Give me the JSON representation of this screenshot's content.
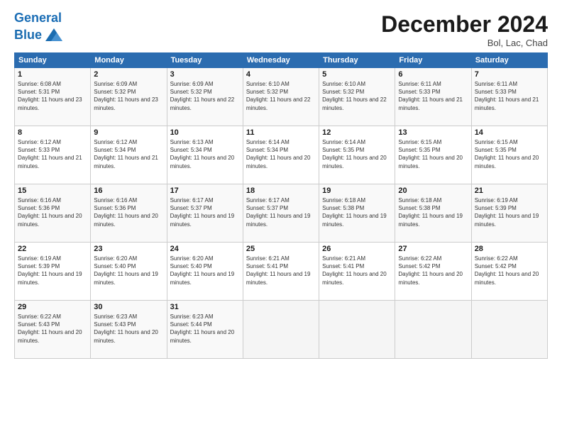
{
  "header": {
    "logo_line1": "General",
    "logo_line2": "Blue",
    "month_title": "December 2024",
    "subtitle": "Bol, Lac, Chad"
  },
  "weekdays": [
    "Sunday",
    "Monday",
    "Tuesday",
    "Wednesday",
    "Thursday",
    "Friday",
    "Saturday"
  ],
  "weeks": [
    [
      {
        "day": "1",
        "sunrise": "6:08 AM",
        "sunset": "5:31 PM",
        "daylight": "11 hours and 23 minutes."
      },
      {
        "day": "2",
        "sunrise": "6:09 AM",
        "sunset": "5:32 PM",
        "daylight": "11 hours and 23 minutes."
      },
      {
        "day": "3",
        "sunrise": "6:09 AM",
        "sunset": "5:32 PM",
        "daylight": "11 hours and 22 minutes."
      },
      {
        "day": "4",
        "sunrise": "6:10 AM",
        "sunset": "5:32 PM",
        "daylight": "11 hours and 22 minutes."
      },
      {
        "day": "5",
        "sunrise": "6:10 AM",
        "sunset": "5:32 PM",
        "daylight": "11 hours and 22 minutes."
      },
      {
        "day": "6",
        "sunrise": "6:11 AM",
        "sunset": "5:33 PM",
        "daylight": "11 hours and 21 minutes."
      },
      {
        "day": "7",
        "sunrise": "6:11 AM",
        "sunset": "5:33 PM",
        "daylight": "11 hours and 21 minutes."
      }
    ],
    [
      {
        "day": "8",
        "sunrise": "6:12 AM",
        "sunset": "5:33 PM",
        "daylight": "11 hours and 21 minutes."
      },
      {
        "day": "9",
        "sunrise": "6:12 AM",
        "sunset": "5:34 PM",
        "daylight": "11 hours and 21 minutes."
      },
      {
        "day": "10",
        "sunrise": "6:13 AM",
        "sunset": "5:34 PM",
        "daylight": "11 hours and 20 minutes."
      },
      {
        "day": "11",
        "sunrise": "6:14 AM",
        "sunset": "5:34 PM",
        "daylight": "11 hours and 20 minutes."
      },
      {
        "day": "12",
        "sunrise": "6:14 AM",
        "sunset": "5:35 PM",
        "daylight": "11 hours and 20 minutes."
      },
      {
        "day": "13",
        "sunrise": "6:15 AM",
        "sunset": "5:35 PM",
        "daylight": "11 hours and 20 minutes."
      },
      {
        "day": "14",
        "sunrise": "6:15 AM",
        "sunset": "5:35 PM",
        "daylight": "11 hours and 20 minutes."
      }
    ],
    [
      {
        "day": "15",
        "sunrise": "6:16 AM",
        "sunset": "5:36 PM",
        "daylight": "11 hours and 20 minutes."
      },
      {
        "day": "16",
        "sunrise": "6:16 AM",
        "sunset": "5:36 PM",
        "daylight": "11 hours and 20 minutes."
      },
      {
        "day": "17",
        "sunrise": "6:17 AM",
        "sunset": "5:37 PM",
        "daylight": "11 hours and 19 minutes."
      },
      {
        "day": "18",
        "sunrise": "6:17 AM",
        "sunset": "5:37 PM",
        "daylight": "11 hours and 19 minutes."
      },
      {
        "day": "19",
        "sunrise": "6:18 AM",
        "sunset": "5:38 PM",
        "daylight": "11 hours and 19 minutes."
      },
      {
        "day": "20",
        "sunrise": "6:18 AM",
        "sunset": "5:38 PM",
        "daylight": "11 hours and 19 minutes."
      },
      {
        "day": "21",
        "sunrise": "6:19 AM",
        "sunset": "5:39 PM",
        "daylight": "11 hours and 19 minutes."
      }
    ],
    [
      {
        "day": "22",
        "sunrise": "6:19 AM",
        "sunset": "5:39 PM",
        "daylight": "11 hours and 19 minutes."
      },
      {
        "day": "23",
        "sunrise": "6:20 AM",
        "sunset": "5:40 PM",
        "daylight": "11 hours and 19 minutes."
      },
      {
        "day": "24",
        "sunrise": "6:20 AM",
        "sunset": "5:40 PM",
        "daylight": "11 hours and 19 minutes."
      },
      {
        "day": "25",
        "sunrise": "6:21 AM",
        "sunset": "5:41 PM",
        "daylight": "11 hours and 19 minutes."
      },
      {
        "day": "26",
        "sunrise": "6:21 AM",
        "sunset": "5:41 PM",
        "daylight": "11 hours and 20 minutes."
      },
      {
        "day": "27",
        "sunrise": "6:22 AM",
        "sunset": "5:42 PM",
        "daylight": "11 hours and 20 minutes."
      },
      {
        "day": "28",
        "sunrise": "6:22 AM",
        "sunset": "5:42 PM",
        "daylight": "11 hours and 20 minutes."
      }
    ],
    [
      {
        "day": "29",
        "sunrise": "6:22 AM",
        "sunset": "5:43 PM",
        "daylight": "11 hours and 20 minutes."
      },
      {
        "day": "30",
        "sunrise": "6:23 AM",
        "sunset": "5:43 PM",
        "daylight": "11 hours and 20 minutes."
      },
      {
        "day": "31",
        "sunrise": "6:23 AM",
        "sunset": "5:44 PM",
        "daylight": "11 hours and 20 minutes."
      },
      null,
      null,
      null,
      null
    ]
  ],
  "labels": {
    "sunrise_prefix": "Sunrise: ",
    "sunset_prefix": "Sunset: ",
    "daylight_prefix": "Daylight: "
  }
}
